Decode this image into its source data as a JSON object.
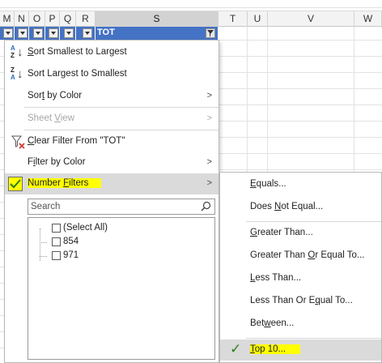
{
  "columns": [
    "M",
    "N",
    "O",
    "P",
    "Q",
    "R",
    "S",
    "T",
    "U",
    "V",
    "W"
  ],
  "filter_header": {
    "label": "TOT"
  },
  "menu": {
    "sort_asc": {
      "label_u": "S",
      "label_rest": "ort Smallest to Largest",
      "icon_top": "A",
      "icon_bottom": "Z"
    },
    "sort_desc": {
      "label_u": "O",
      "label_rest": "Sort Largest to Smallest",
      "icon_top": "Z",
      "icon_bottom": "A"
    },
    "sort_by_color": {
      "label_pre": "Sor",
      "label_u": "t",
      "label_post": " by Color"
    },
    "sheet_view": {
      "label_pre": "Sheet ",
      "label_u": "V",
      "label_post": "iew"
    },
    "clear_filter": {
      "label_u": "C",
      "label_rest": "lear Filter From \"TOT\""
    },
    "filter_by_color": {
      "label_u": "I",
      "label_pre": "F",
      "label_post": "lter by Color"
    },
    "number_filters": {
      "label_pre": "Number ",
      "label_u": "F",
      "label_post": "ilters"
    },
    "search_placeholder": "Search",
    "list": [
      {
        "label": "(Select All)"
      },
      {
        "label": "854"
      },
      {
        "label": "971"
      }
    ],
    "arrow": ">"
  },
  "submenu": {
    "items": [
      {
        "pre": "",
        "u": "E",
        "post": "quals..."
      },
      {
        "pre": "Does ",
        "u": "N",
        "post": "ot Equal..."
      },
      {
        "pre": "",
        "u": "G",
        "post": "reater Than..."
      },
      {
        "pre": "Greater Than ",
        "u": "O",
        "post": "r Equal To..."
      },
      {
        "pre": "",
        "u": "L",
        "post": "ess Than..."
      },
      {
        "pre": "Less Than Or E",
        "u": "q",
        "post": "ual To..."
      },
      {
        "pre": "Bet",
        "u": "w",
        "post": "een..."
      },
      {
        "pre": "",
        "u": "T",
        "post": "op 10..."
      }
    ]
  },
  "colors": {
    "header_blue": "#4472c4",
    "highlight": "#ffff00",
    "check_green": "#2e7d1a"
  }
}
